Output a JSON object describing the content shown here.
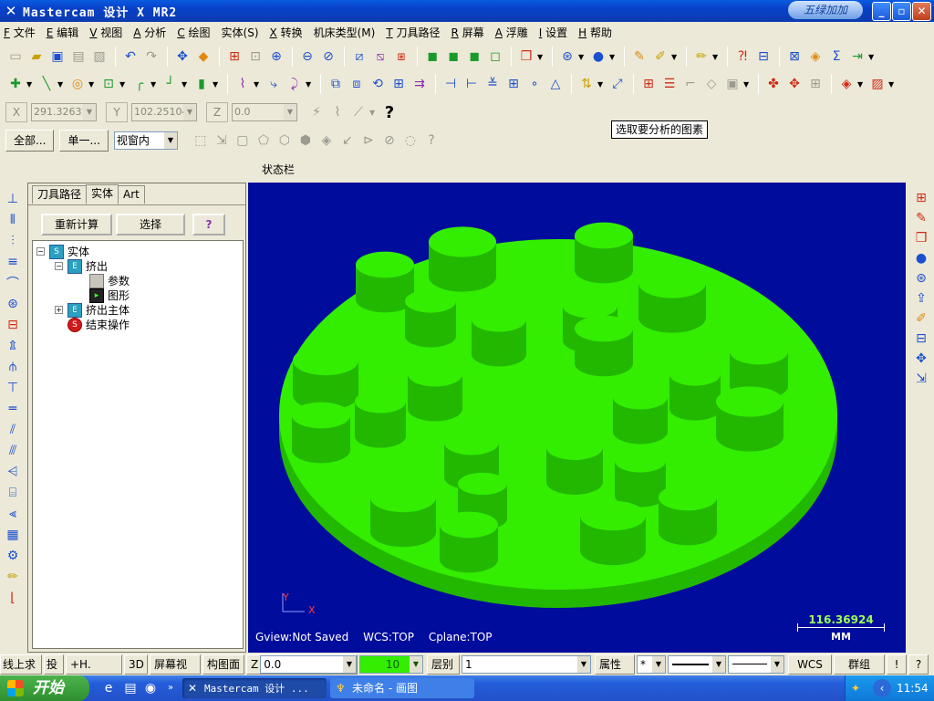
{
  "window": {
    "title": "Mastercam 设计  X MR2",
    "brand": "五绿加加",
    "min": "_",
    "max": "▫",
    "close": "✕"
  },
  "menu": [
    {
      "key": "F",
      "label": "文件"
    },
    {
      "key": "E",
      "label": "编辑"
    },
    {
      "key": "V",
      "label": "视图"
    },
    {
      "key": "A",
      "label": "分析"
    },
    {
      "key": "C",
      "label": "绘图"
    },
    {
      "key": "",
      "label": "实体(S)"
    },
    {
      "key": "X",
      "label": "转换"
    },
    {
      "key": "",
      "label": "机床类型(M)"
    },
    {
      "key": "T",
      "label": "刀具路径"
    },
    {
      "key": "R",
      "label": "屏幕"
    },
    {
      "key": "A",
      "label": "浮雕"
    },
    {
      "key": "I",
      "label": "设置"
    },
    {
      "key": "H",
      "label": "帮助"
    }
  ],
  "coords": {
    "x_label": "X",
    "x_value": "291.32631",
    "y_label": "Y",
    "y_value": "102.25104",
    "z_label": "Z",
    "z_value": "0.0",
    "help": "?"
  },
  "select_bar": {
    "all": "全部...",
    "single": "单一...",
    "mode": "视窗内"
  },
  "tooltip": "选取要分析的图素",
  "status_label": "状态栏",
  "panel": {
    "tabs": [
      "刀具路径",
      "实体",
      "Art"
    ],
    "active_tab": 1,
    "recalc": "重新计算",
    "select": "选择",
    "help": "?",
    "tree": [
      {
        "label": "实体",
        "expander": "−"
      },
      {
        "label": "挤出",
        "expander": "−"
      },
      {
        "label": "参数",
        "expander": ""
      },
      {
        "label": "图形",
        "expander": ""
      },
      {
        "label": "挤出主体",
        "expander": "+"
      },
      {
        "label": "结束操作",
        "expander": ""
      }
    ]
  },
  "viewport": {
    "gview": "Gview:Not Saved",
    "wcs": "WCS:TOP",
    "cplane": "Cplane:TOP",
    "scale_value": "116.36924",
    "scale_unit": "MM",
    "axis_x": "X",
    "axis_y": "Y",
    "background": "#000c9c",
    "solid_color": "#33ee00",
    "solid_side": "#22b800"
  },
  "statusbar": {
    "a": "线上求点",
    "b": "投",
    "c": "+H.",
    "d": "3D",
    "e": "屏幕视角",
    "f": "构图面",
    "z_label": "Z",
    "z_value": "0.0",
    "color_value": "10",
    "level_label": "层别",
    "level_value": "1",
    "attr": "属性",
    "marker": "*",
    "wcs": "WCS",
    "group": "群组",
    "bang": "!",
    "help": "?"
  },
  "taskbar": {
    "start": "开始",
    "tasks": [
      "Mastercam 设计 ...",
      "未命名 - 画图"
    ],
    "clock": "11:54"
  },
  "icons": {
    "toolbar1": [
      "new-icon",
      "open-icon",
      "save-icon",
      "print-icon",
      "print-preview-icon",
      "undo-icon",
      "redo-icon",
      "pan-icon",
      "autocursor-icon",
      "zoom-window-icon",
      "zoom-target-icon",
      "zoom-in-icon",
      "zoom-out-icon",
      "unzoom-icon",
      "dimension-icon",
      "dimension2-icon",
      "dimension3-icon",
      "cube-top-icon",
      "cube-front-icon",
      "cube-side-icon",
      "cube-iso-icon",
      "view-cube-icon",
      "globe-icon",
      "sphere-icon",
      "ruler-icon",
      "measure-icon",
      "pen-icon",
      "help-ruler-icon",
      "toolpath-icon",
      "op-manager-icon",
      "solid-icon",
      "sum-icon",
      "export-icon"
    ],
    "toolbar2": [
      "point-icon",
      "line-icon",
      "circle-icon",
      "rectangle-icon",
      "fillet-icon",
      "spline-icon",
      "cylinder-icon",
      "trim-icon",
      "chamfer-icon",
      "offset-icon",
      "array-icon",
      "mirror-icon",
      "rotate-icon",
      "scale-icon",
      "translate-icon",
      "break-icon",
      "join-icon",
      "layer-icon",
      "grid-icon",
      "snap-icon",
      "mesh-icon",
      "drill-icon",
      "letters-icon",
      "table-icon",
      "list-icon",
      "clip-icon",
      "tag-icon",
      "rect-sel-icon",
      "shade-icon",
      "wire-icon",
      "render-icon"
    ]
  }
}
